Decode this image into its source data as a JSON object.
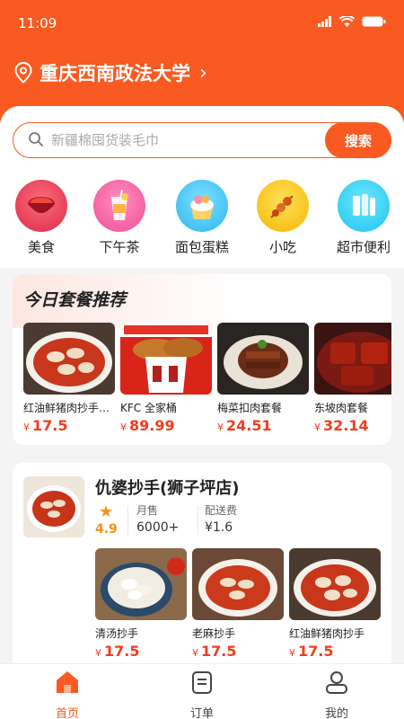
{
  "status_bar": {
    "time": "11:09"
  },
  "location": {
    "name": "重庆西南政法大学",
    "chevron": "›"
  },
  "search": {
    "placeholder": "新疆棉囤货装毛巾",
    "button_label": "搜索"
  },
  "categories": [
    {
      "label": "美食",
      "icon": "hotpot-icon"
    },
    {
      "label": "下午茶",
      "icon": "drink-icon"
    },
    {
      "label": "面包蛋糕",
      "icon": "cake-icon"
    },
    {
      "label": "小吃",
      "icon": "skewer-icon"
    },
    {
      "label": "超市便利",
      "icon": "supermarket-icon"
    }
  ],
  "combo_section": {
    "title": "今日套餐推荐",
    "currency": "¥",
    "items": [
      {
        "name": "红油鲜猪肉抄手套餐",
        "price": "17.5"
      },
      {
        "name": "KFC 全家桶",
        "price": "89.99"
      },
      {
        "name": "梅菜扣肉套餐",
        "price": "24.51"
      },
      {
        "name": "东坡肉套餐",
        "price": "32.14"
      }
    ]
  },
  "shop": {
    "name": "仇婆抄手(狮子坪店)",
    "rating": "4.9",
    "monthly_sales_label": "月售",
    "monthly_sales": "6000+",
    "delivery_fee_label": "配送费",
    "delivery_fee": "¥1.6",
    "currency": "¥",
    "items": [
      {
        "name": "清汤抄手",
        "price": "17.5"
      },
      {
        "name": "老麻抄手",
        "price": "17.5"
      },
      {
        "name": "红油鲜猪肉抄手",
        "price": "17.5"
      }
    ]
  },
  "tabbar": {
    "items": [
      {
        "label": "首页",
        "active": true
      },
      {
        "label": "订单",
        "active": false
      },
      {
        "label": "我的",
        "active": false
      }
    ]
  },
  "colors": {
    "accent": "#f95a21",
    "price": "#f43c1c",
    "rating": "#f4901e"
  }
}
